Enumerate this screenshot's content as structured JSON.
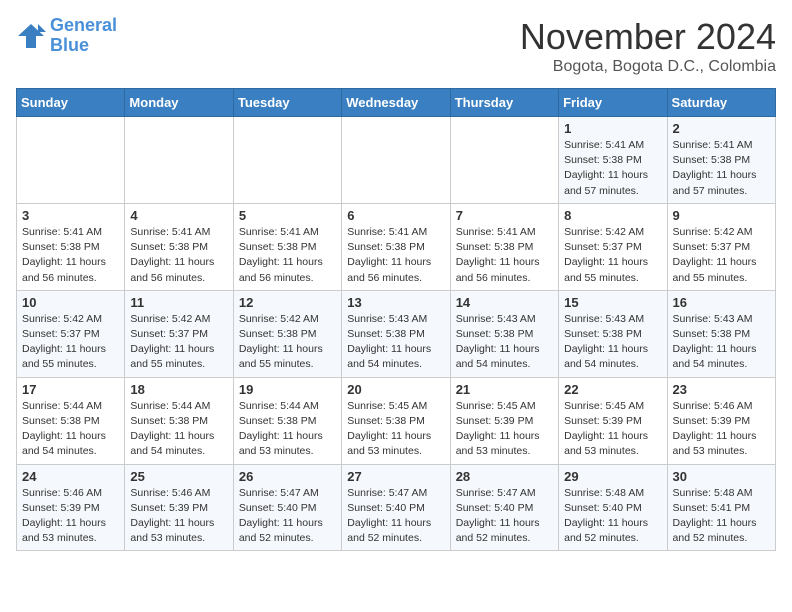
{
  "header": {
    "logo_line1": "General",
    "logo_line2": "Blue",
    "month": "November 2024",
    "location": "Bogota, Bogota D.C., Colombia"
  },
  "weekdays": [
    "Sunday",
    "Monday",
    "Tuesday",
    "Wednesday",
    "Thursday",
    "Friday",
    "Saturday"
  ],
  "weeks": [
    [
      {
        "day": "",
        "info": ""
      },
      {
        "day": "",
        "info": ""
      },
      {
        "day": "",
        "info": ""
      },
      {
        "day": "",
        "info": ""
      },
      {
        "day": "",
        "info": ""
      },
      {
        "day": "1",
        "info": "Sunrise: 5:41 AM\nSunset: 5:38 PM\nDaylight: 11 hours\nand 57 minutes."
      },
      {
        "day": "2",
        "info": "Sunrise: 5:41 AM\nSunset: 5:38 PM\nDaylight: 11 hours\nand 57 minutes."
      }
    ],
    [
      {
        "day": "3",
        "info": "Sunrise: 5:41 AM\nSunset: 5:38 PM\nDaylight: 11 hours\nand 56 minutes."
      },
      {
        "day": "4",
        "info": "Sunrise: 5:41 AM\nSunset: 5:38 PM\nDaylight: 11 hours\nand 56 minutes."
      },
      {
        "day": "5",
        "info": "Sunrise: 5:41 AM\nSunset: 5:38 PM\nDaylight: 11 hours\nand 56 minutes."
      },
      {
        "day": "6",
        "info": "Sunrise: 5:41 AM\nSunset: 5:38 PM\nDaylight: 11 hours\nand 56 minutes."
      },
      {
        "day": "7",
        "info": "Sunrise: 5:41 AM\nSunset: 5:38 PM\nDaylight: 11 hours\nand 56 minutes."
      },
      {
        "day": "8",
        "info": "Sunrise: 5:42 AM\nSunset: 5:37 PM\nDaylight: 11 hours\nand 55 minutes."
      },
      {
        "day": "9",
        "info": "Sunrise: 5:42 AM\nSunset: 5:37 PM\nDaylight: 11 hours\nand 55 minutes."
      }
    ],
    [
      {
        "day": "10",
        "info": "Sunrise: 5:42 AM\nSunset: 5:37 PM\nDaylight: 11 hours\nand 55 minutes."
      },
      {
        "day": "11",
        "info": "Sunrise: 5:42 AM\nSunset: 5:37 PM\nDaylight: 11 hours\nand 55 minutes."
      },
      {
        "day": "12",
        "info": "Sunrise: 5:42 AM\nSunset: 5:38 PM\nDaylight: 11 hours\nand 55 minutes."
      },
      {
        "day": "13",
        "info": "Sunrise: 5:43 AM\nSunset: 5:38 PM\nDaylight: 11 hours\nand 54 minutes."
      },
      {
        "day": "14",
        "info": "Sunrise: 5:43 AM\nSunset: 5:38 PM\nDaylight: 11 hours\nand 54 minutes."
      },
      {
        "day": "15",
        "info": "Sunrise: 5:43 AM\nSunset: 5:38 PM\nDaylight: 11 hours\nand 54 minutes."
      },
      {
        "day": "16",
        "info": "Sunrise: 5:43 AM\nSunset: 5:38 PM\nDaylight: 11 hours\nand 54 minutes."
      }
    ],
    [
      {
        "day": "17",
        "info": "Sunrise: 5:44 AM\nSunset: 5:38 PM\nDaylight: 11 hours\nand 54 minutes."
      },
      {
        "day": "18",
        "info": "Sunrise: 5:44 AM\nSunset: 5:38 PM\nDaylight: 11 hours\nand 54 minutes."
      },
      {
        "day": "19",
        "info": "Sunrise: 5:44 AM\nSunset: 5:38 PM\nDaylight: 11 hours\nand 53 minutes."
      },
      {
        "day": "20",
        "info": "Sunrise: 5:45 AM\nSunset: 5:38 PM\nDaylight: 11 hours\nand 53 minutes."
      },
      {
        "day": "21",
        "info": "Sunrise: 5:45 AM\nSunset: 5:39 PM\nDaylight: 11 hours\nand 53 minutes."
      },
      {
        "day": "22",
        "info": "Sunrise: 5:45 AM\nSunset: 5:39 PM\nDaylight: 11 hours\nand 53 minutes."
      },
      {
        "day": "23",
        "info": "Sunrise: 5:46 AM\nSunset: 5:39 PM\nDaylight: 11 hours\nand 53 minutes."
      }
    ],
    [
      {
        "day": "24",
        "info": "Sunrise: 5:46 AM\nSunset: 5:39 PM\nDaylight: 11 hours\nand 53 minutes."
      },
      {
        "day": "25",
        "info": "Sunrise: 5:46 AM\nSunset: 5:39 PM\nDaylight: 11 hours\nand 53 minutes."
      },
      {
        "day": "26",
        "info": "Sunrise: 5:47 AM\nSunset: 5:40 PM\nDaylight: 11 hours\nand 52 minutes."
      },
      {
        "day": "27",
        "info": "Sunrise: 5:47 AM\nSunset: 5:40 PM\nDaylight: 11 hours\nand 52 minutes."
      },
      {
        "day": "28",
        "info": "Sunrise: 5:47 AM\nSunset: 5:40 PM\nDaylight: 11 hours\nand 52 minutes."
      },
      {
        "day": "29",
        "info": "Sunrise: 5:48 AM\nSunset: 5:40 PM\nDaylight: 11 hours\nand 52 minutes."
      },
      {
        "day": "30",
        "info": "Sunrise: 5:48 AM\nSunset: 5:41 PM\nDaylight: 11 hours\nand 52 minutes."
      }
    ]
  ]
}
